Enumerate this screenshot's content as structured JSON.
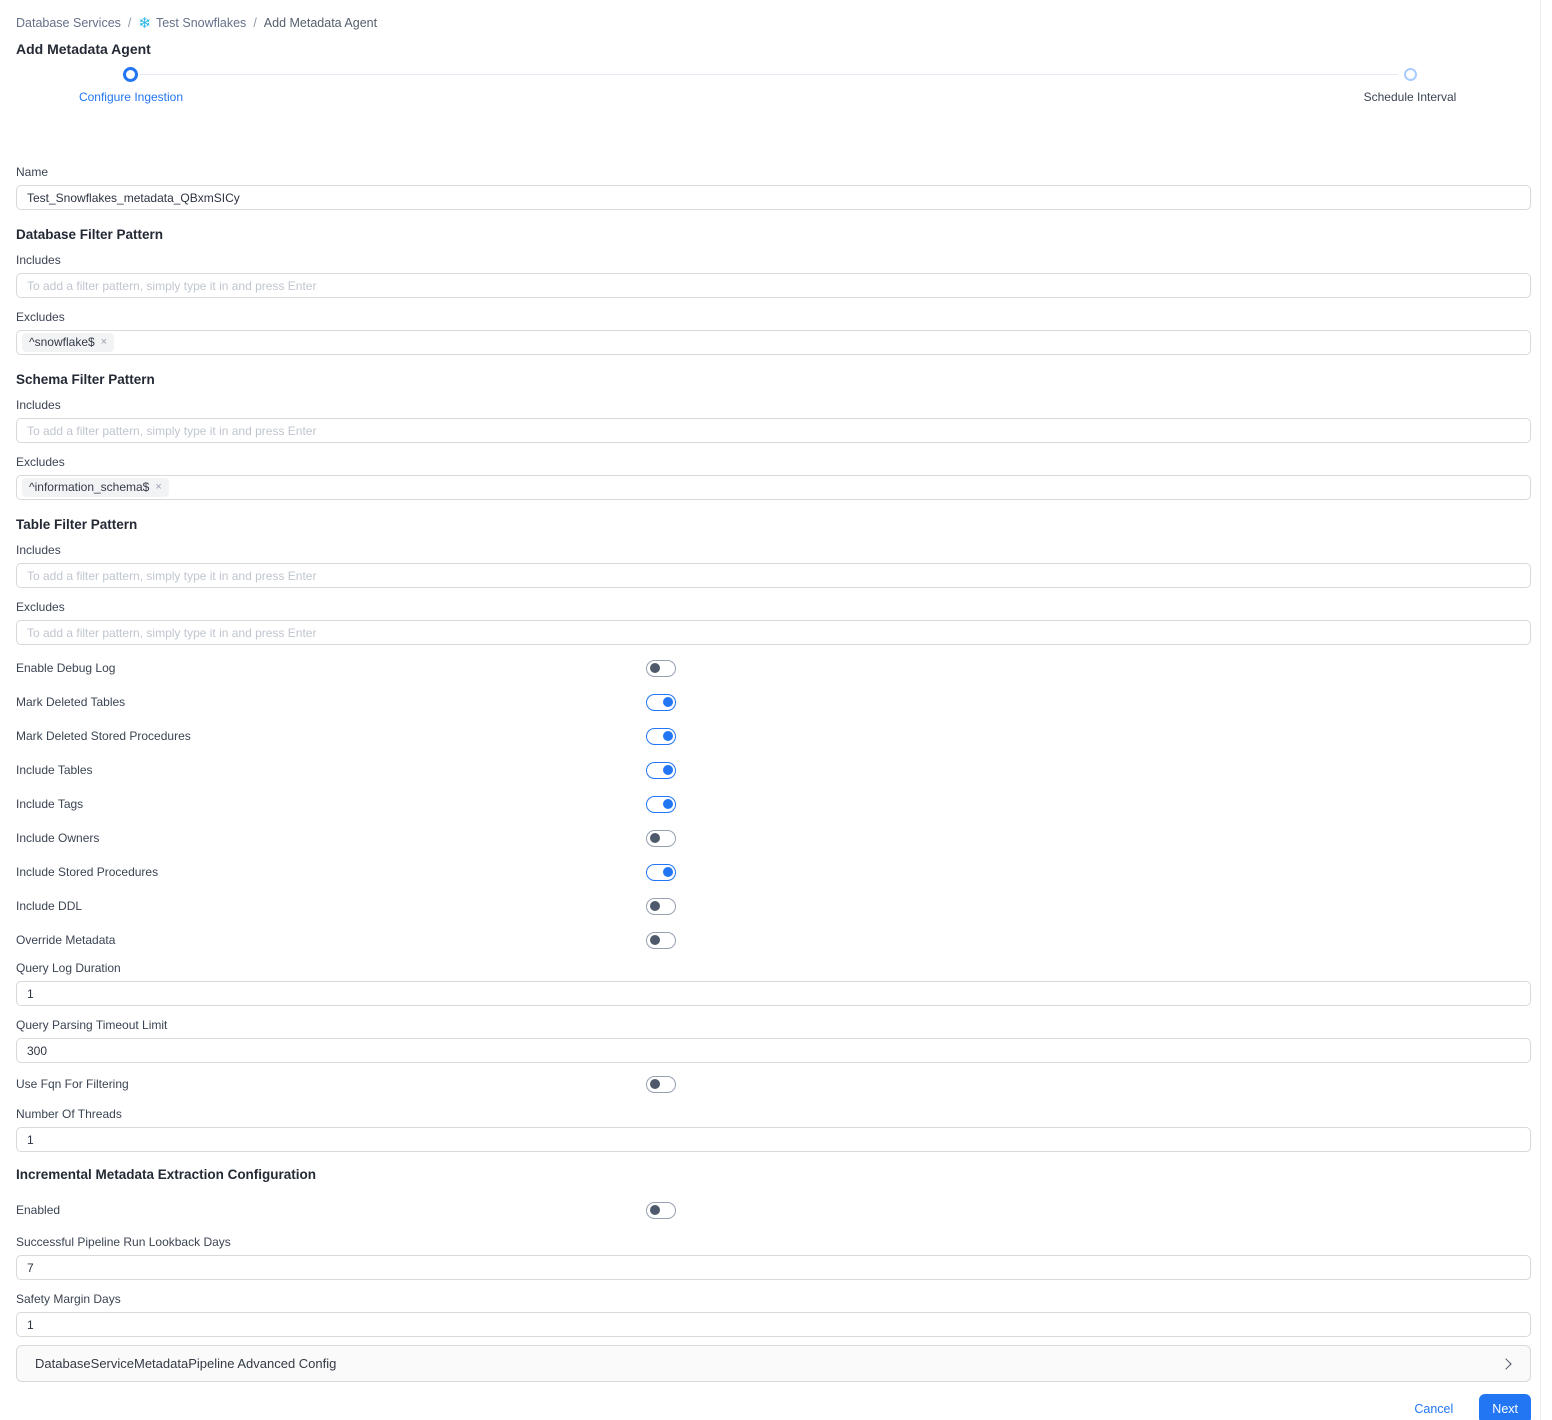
{
  "colors": {
    "primary": "#2276f3",
    "snowflake_blue": "#29b5e8"
  },
  "breadcrumb": {
    "separator": "/",
    "items": [
      {
        "label": "Database Services"
      },
      {
        "label": "Test Snowflakes",
        "icon": "snowflake-icon"
      },
      {
        "label": "Add Metadata Agent"
      }
    ]
  },
  "page": {
    "title": "Add Metadata Agent"
  },
  "stepper": {
    "steps": [
      {
        "label": "Configure Ingestion",
        "state": "active"
      },
      {
        "label": "Schedule Interval",
        "state": "pending"
      }
    ]
  },
  "form": {
    "name": {
      "label": "Name",
      "value": "Test_Snowflakes_metadata_QBxmSICy"
    },
    "filter_placeholder": "To add a filter pattern, simply type it in and press Enter",
    "chip_remove_icon": "×",
    "filter_sections": [
      {
        "title": "Database Filter Pattern",
        "includes_label": "Includes",
        "excludes_label": "Excludes",
        "excludes_chips": [
          "^snowflake$"
        ]
      },
      {
        "title": "Schema Filter Pattern",
        "includes_label": "Includes",
        "excludes_label": "Excludes",
        "excludes_chips": [
          "^information_schema$"
        ]
      },
      {
        "title": "Table Filter Pattern",
        "includes_label": "Includes",
        "excludes_label": "Excludes",
        "excludes_chips": []
      }
    ],
    "toggles": [
      {
        "label": "Enable Debug Log",
        "on": false
      },
      {
        "label": "Mark Deleted Tables",
        "on": true
      },
      {
        "label": "Mark Deleted Stored Procedures",
        "on": true
      },
      {
        "label": "Include Tables",
        "on": true
      },
      {
        "label": "Include Tags",
        "on": true
      },
      {
        "label": "Include Owners",
        "on": false
      },
      {
        "label": "Include Stored Procedures",
        "on": true
      },
      {
        "label": "Include DDL",
        "on": false
      },
      {
        "label": "Override Metadata",
        "on": false
      }
    ],
    "query_log_duration": {
      "label": "Query Log Duration",
      "value": "1"
    },
    "query_parsing_timeout_limit": {
      "label": "Query Parsing Timeout Limit",
      "value": "300"
    },
    "use_fqn_for_filtering": {
      "label": "Use Fqn For Filtering",
      "on": false
    },
    "number_of_threads": {
      "label": "Number Of Threads",
      "value": "1"
    },
    "incremental": {
      "title": "Incremental Metadata Extraction Configuration",
      "enabled": {
        "label": "Enabled",
        "on": false
      },
      "lookback_days": {
        "label": "Successful Pipeline Run Lookback Days",
        "value": "7"
      },
      "safety_margin_days": {
        "label": "Safety Margin Days",
        "value": "1"
      }
    },
    "advanced_panel": {
      "label": "DatabaseServiceMetadataPipeline Advanced Config"
    }
  },
  "footer": {
    "cancel_label": "Cancel",
    "next_label": "Next"
  }
}
